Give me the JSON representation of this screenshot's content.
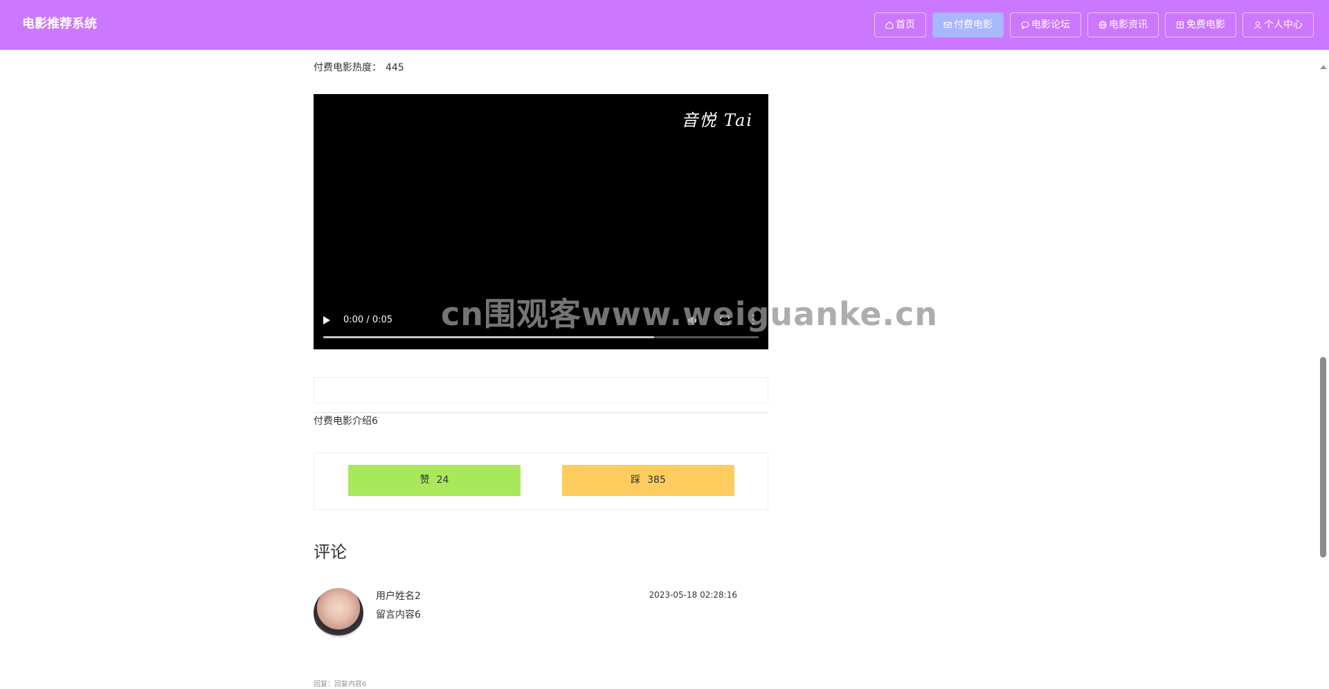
{
  "header": {
    "brand": "电影推荐系统",
    "nav": [
      {
        "label": "首页",
        "icon": "home-icon",
        "active": false
      },
      {
        "label": "付费电影",
        "icon": "mail-icon",
        "active": true
      },
      {
        "label": "电影论坛",
        "icon": "chat-icon",
        "active": false
      },
      {
        "label": "电影资讯",
        "icon": "globe-icon",
        "active": false
      },
      {
        "label": "免费电影",
        "icon": "grid-icon",
        "active": false
      },
      {
        "label": "个人中心",
        "icon": "user-icon",
        "active": false
      }
    ],
    "colors": {
      "background": "#cc77ff",
      "active_button": "#a8b8ff"
    }
  },
  "movie": {
    "popularity_label": "付费电影热度：",
    "popularity_value": "445",
    "intro": "付费电影介绍6"
  },
  "video": {
    "watermark_text": "音悦 Tai",
    "time": "0:00 / 0:05",
    "progress": 0.76
  },
  "page_watermark": "cn围观客www.weiguanke.cn",
  "votes": {
    "like_label": "赞",
    "like_count": "24",
    "dislike_label": "踩",
    "dislike_count": "385",
    "colors": {
      "like": "#a8e85a",
      "dislike": "#ffcc60"
    }
  },
  "comments": {
    "title": "评论",
    "items": [
      {
        "user": "用户姓名2",
        "content": "留言内容6",
        "time": "2023-05-18 02:28:16",
        "reply": "回复：回复内容6"
      }
    ]
  }
}
